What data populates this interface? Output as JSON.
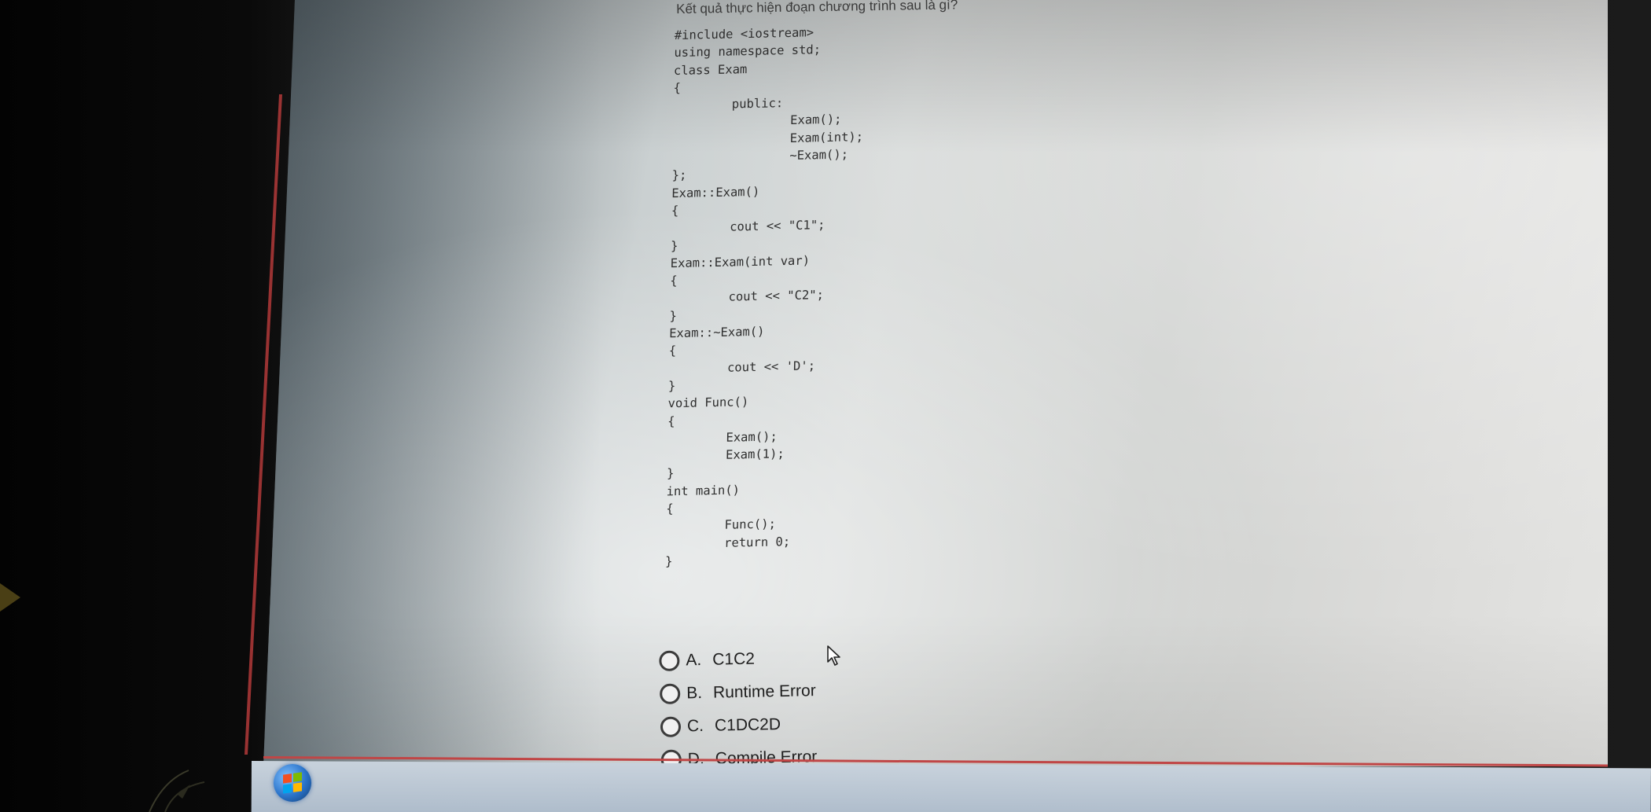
{
  "question": {
    "title": "Kết quả thực hiện đoạn chương trình sau là gì?"
  },
  "code_lines": [
    "#include <iostream>",
    "using namespace std;",
    "class Exam",
    "{",
    "        public:",
    "                Exam();",
    "                Exam(int);",
    "                ~Exam();",
    "};",
    "Exam::Exam()",
    "{",
    "        cout << \"C1\";",
    "}",
    "Exam::Exam(int var)",
    "{",
    "        cout << \"C2\";",
    "}",
    "Exam::~Exam()",
    "{",
    "        cout << 'D';",
    "}",
    "void Func()",
    "{",
    "        Exam();",
    "        Exam(1);",
    "}",
    "int main()",
    "{",
    "        Func();",
    "        return 0;",
    "}"
  ],
  "options": [
    {
      "letter": "A.",
      "text": "C1C2"
    },
    {
      "letter": "B.",
      "text": "Runtime Error"
    },
    {
      "letter": "C.",
      "text": "C1DC2D"
    },
    {
      "letter": "D.",
      "text": "Compile Error"
    }
  ],
  "taskbar": {
    "start_icon": "windows-start-orb"
  }
}
